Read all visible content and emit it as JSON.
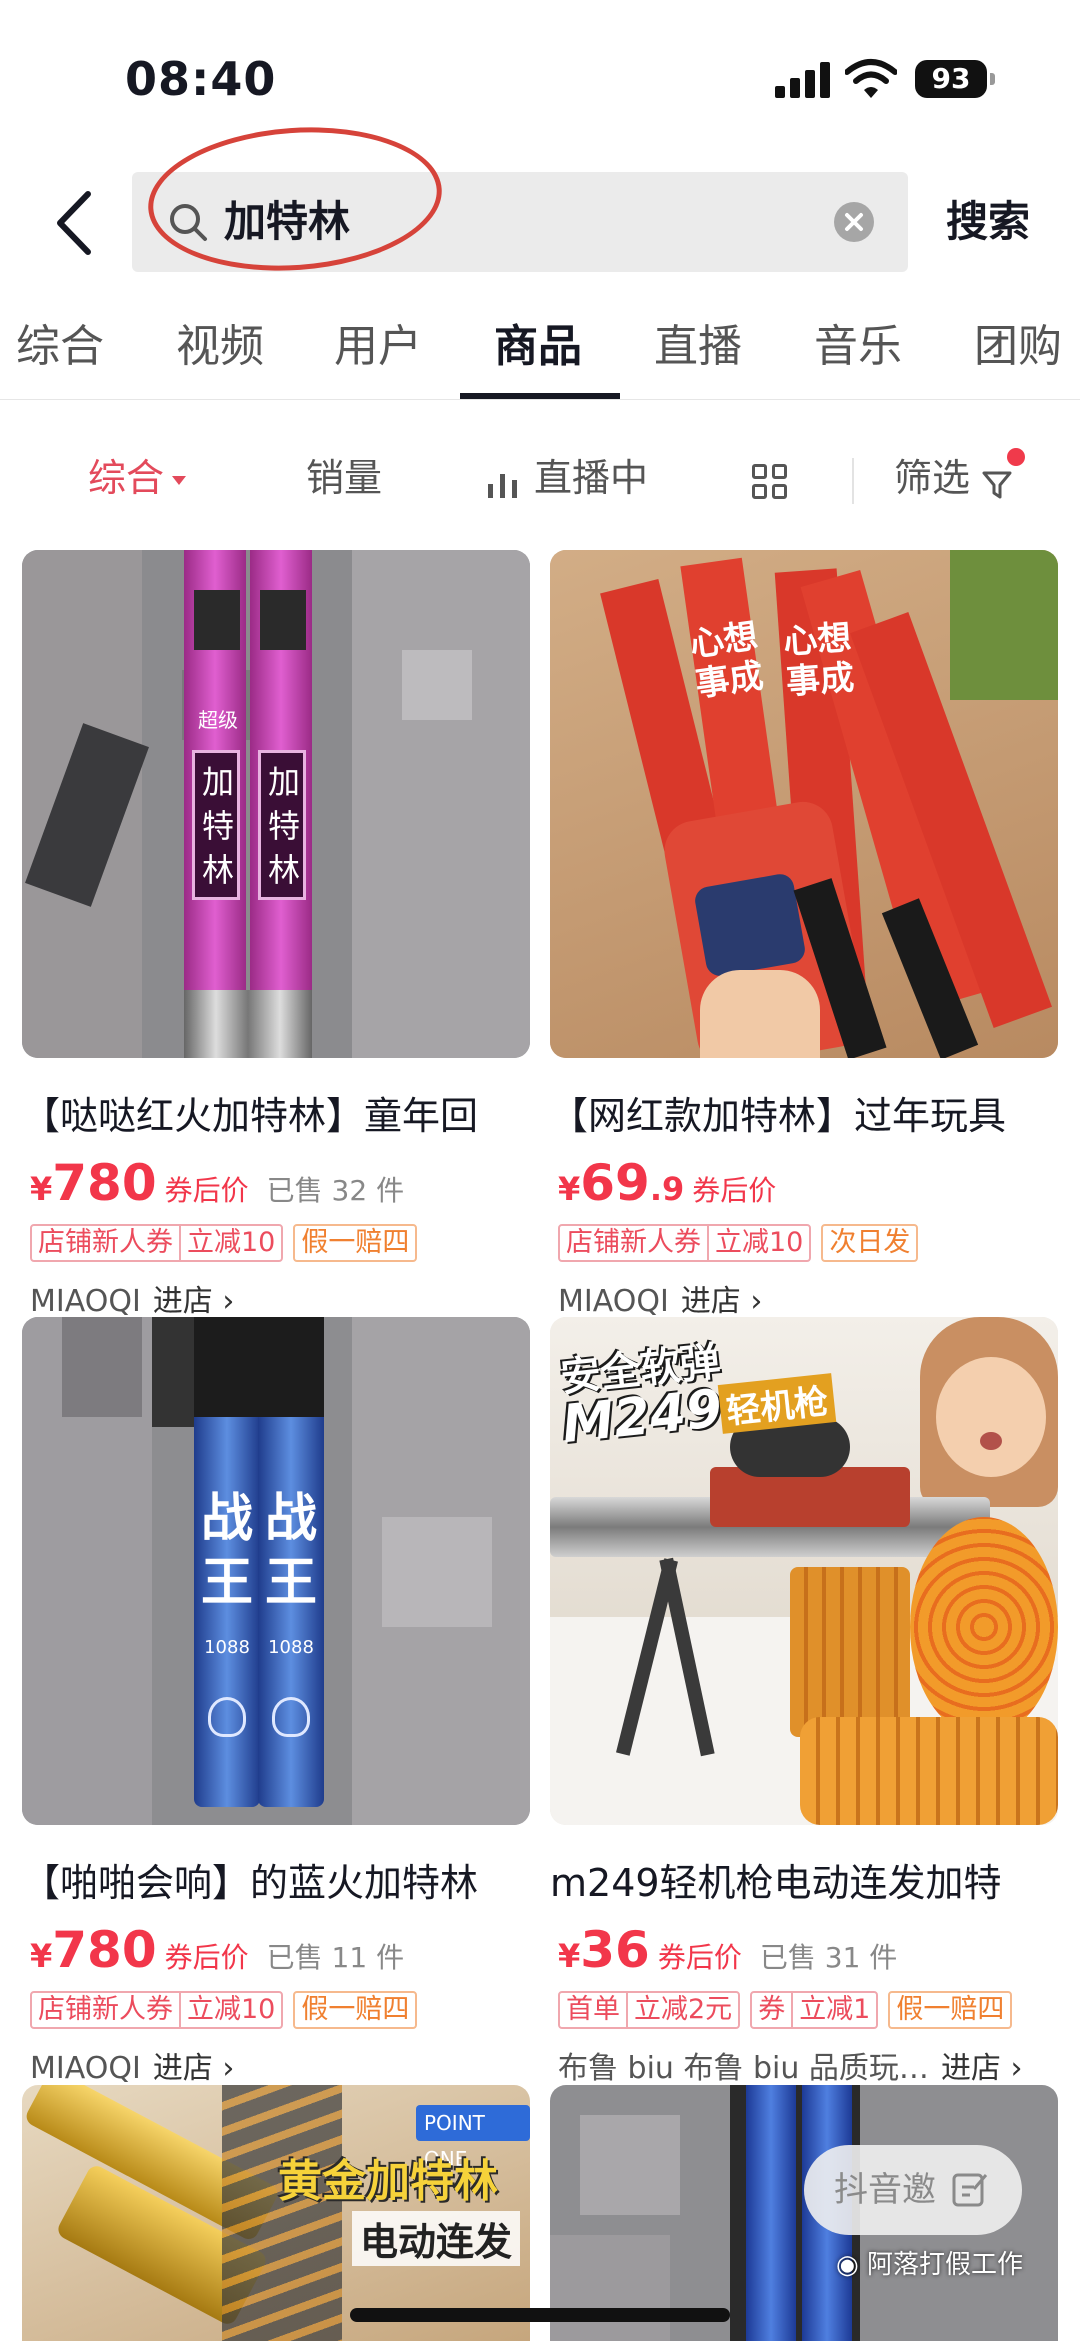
{
  "status_bar": {
    "time": "08:40",
    "battery": "93"
  },
  "header": {
    "query": "加特林",
    "search_label": "搜索"
  },
  "tabs": [
    {
      "label": "综合",
      "active": false
    },
    {
      "label": "视频",
      "active": false
    },
    {
      "label": "用户",
      "active": false
    },
    {
      "label": "商品",
      "active": true
    },
    {
      "label": "直播",
      "active": false
    },
    {
      "label": "音乐",
      "active": false
    },
    {
      "label": "团购",
      "active": false
    }
  ],
  "filters": {
    "comprehensive": "综合",
    "sales": "销量",
    "live": "直播中",
    "filter": "筛选"
  },
  "products": [
    {
      "title": "【哒哒红火加特林】童年回",
      "price_symbol": "¥",
      "price_int": "780",
      "price_dec": "",
      "price_tag": "券后价",
      "sold": "已售 32 件",
      "badge_a": "店铺新人券",
      "badge_b": "立减10",
      "badge_c": "假一赔四",
      "shop": "MIAOQI",
      "enter": "进店 ›",
      "image_text": [
        "超级",
        "加特林"
      ]
    },
    {
      "title": "【网红款加特林】过年玩具",
      "price_symbol": "¥",
      "price_int": "69",
      "price_dec": ".9",
      "price_tag": "券后价",
      "sold": "",
      "badge_a": "店铺新人券",
      "badge_b": "立减10",
      "badge_c": "次日发",
      "shop": "MIAOQI",
      "enter": "进店 ›",
      "image_text": [
        "心想事成"
      ]
    },
    {
      "title": "【啪啪会响】的蓝火加特林",
      "price_symbol": "¥",
      "price_int": "780",
      "price_dec": "",
      "price_tag": "券后价",
      "sold": "已售 11 件",
      "badge_a": "店铺新人券",
      "badge_b": "立减10",
      "badge_c": "假一赔四",
      "shop": "MIAOQI",
      "enter": "进店 ›",
      "image_text": [
        "战王",
        "1088"
      ]
    },
    {
      "title": "m249轻机枪电动连发加特",
      "price_symbol": "¥",
      "price_int": "36",
      "price_dec": "",
      "price_tag": "券后价",
      "sold": "已售 31 件",
      "badge_a": "首单",
      "badge_b": "立减2元",
      "badge_c": "券",
      "badge_d": "立减1",
      "badge_e": "假一赔四",
      "shop": "布鲁 biu 布鲁 biu 品质玩…",
      "enter": "进店 ›",
      "image_text": [
        "安全软弹",
        "M249",
        "轻机枪"
      ]
    },
    {
      "title": "",
      "image_text": [
        "POINT",
        "ONE",
        "黄金加特林",
        "电动连发"
      ]
    },
    {
      "title": "",
      "image_text": []
    }
  ],
  "float_button": "抖音邀",
  "watermark": "阿落打假工作"
}
